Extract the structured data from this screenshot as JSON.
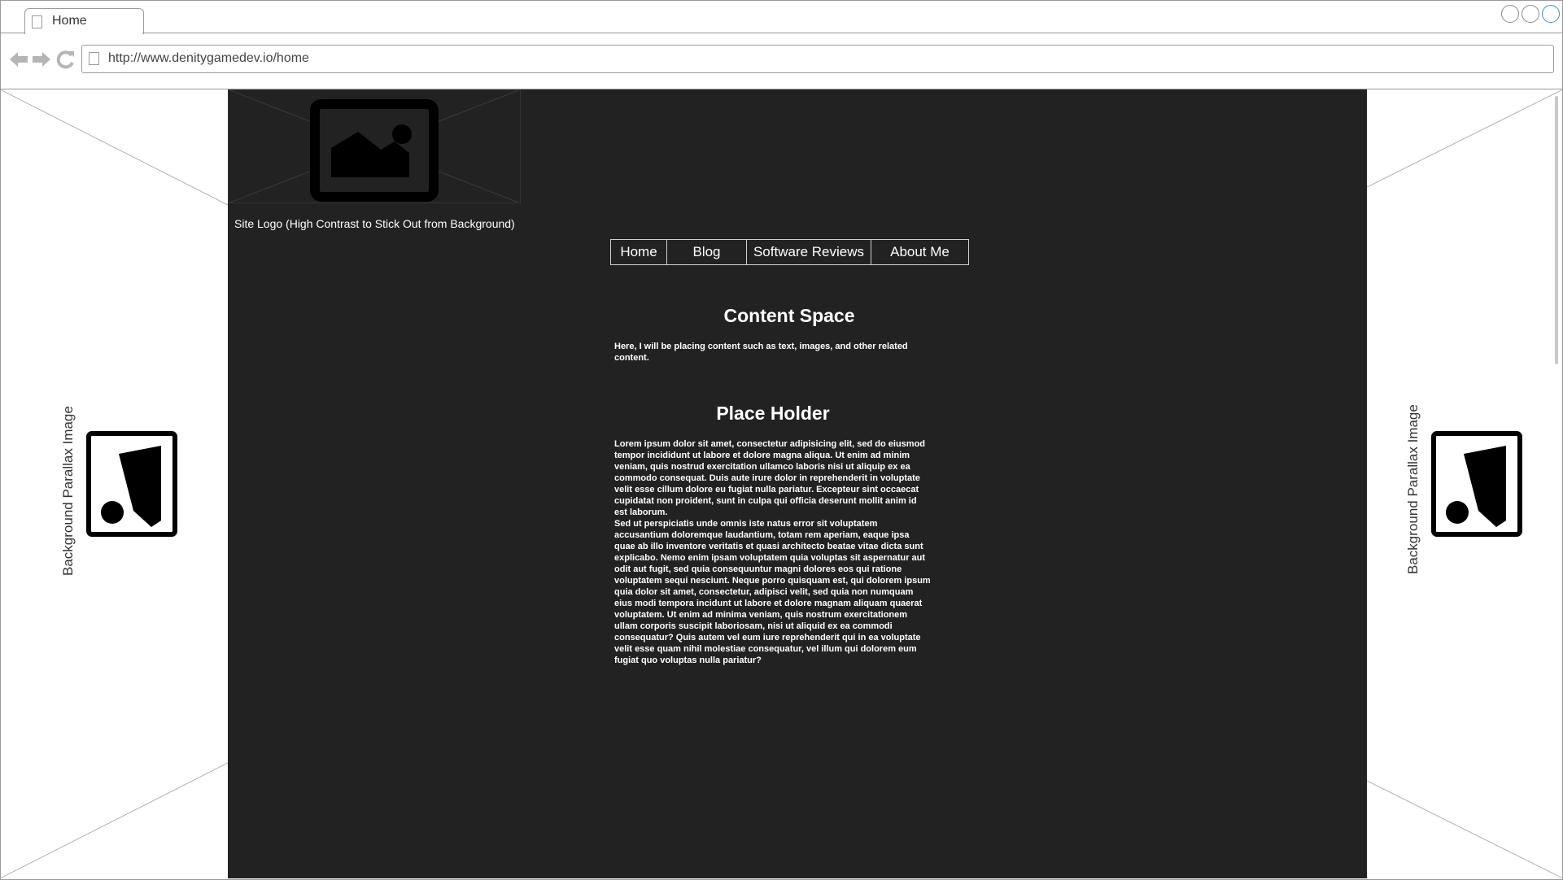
{
  "browser": {
    "tab_title": "Home",
    "url": "http://www.denitygamedev.io/home",
    "nav_icons": [
      "back-arrow-icon",
      "forward-arrow-icon",
      "reload-icon"
    ]
  },
  "sides": {
    "left_label": "Background Parallax Image",
    "right_label": "Background Parallax Image"
  },
  "site": {
    "logo_caption": "Site Logo (High Contrast to Stick Out from Background)",
    "nav": [
      "Home",
      "Blog",
      "Software Reviews",
      "About Me"
    ],
    "content_heading": "Content Space",
    "content_text": "Here, I will be placing content such as text, images, and other related content.",
    "placeholder_heading": "Place Holder",
    "placeholder_text_1": "Lorem ipsum dolor sit amet, consectetur adipisicing elit, sed do eiusmod tempor incididunt ut labore et dolore magna aliqua. Ut enim ad minim veniam, quis nostrud exercitation ullamco laboris nisi ut aliquip ex ea commodo consequat. Duis aute irure dolor in reprehenderit in voluptate velit esse cillum dolore eu fugiat nulla pariatur. Excepteur sint occaecat cupidatat non proident, sunt in culpa qui officia deserunt mollit anim id est laborum.",
    "placeholder_text_2": "Sed ut perspiciatis unde omnis iste natus error sit voluptatem accusantium doloremque laudantium, totam rem aperiam, eaque ipsa quae ab illo inventore veritatis et quasi architecto beatae vitae dicta sunt explicabo. Nemo enim ipsam voluptatem quia voluptas sit aspernatur aut odit aut fugit, sed quia consequuntur magni dolores eos qui ratione voluptatem sequi nesciunt. Neque porro quisquam est, qui dolorem ipsum quia dolor sit amet, consectetur, adipisci velit, sed quia non numquam eius modi tempora incidunt ut labore et dolore magnam aliquam quaerat voluptatem. Ut enim ad minima veniam, quis nostrum exercitationem ullam corporis suscipit laboriosam, nisi ut aliquid ex ea commodi consequatur? Quis autem vel eum iure reprehenderit qui in ea voluptate velit esse quam nihil molestiae consequatur, vel illum qui dolorem eum fugiat quo voluptas nulla pariatur?"
  },
  "colors": {
    "main_background": "#222222",
    "text": "#ffffff",
    "window_close_accent": "#3b8fd6"
  }
}
